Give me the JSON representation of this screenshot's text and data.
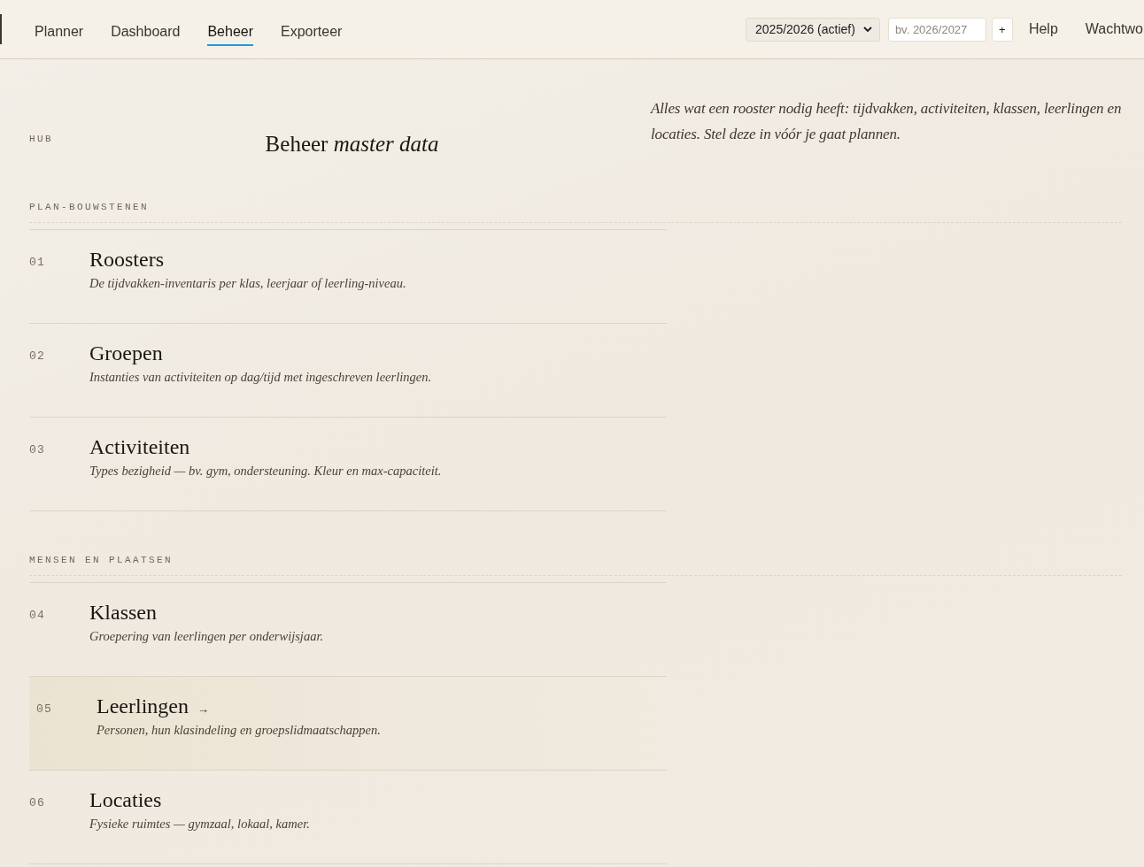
{
  "topbar": {
    "tabs": [
      {
        "label": "Planner",
        "selected": false
      },
      {
        "label": "Dashboard",
        "selected": false
      },
      {
        "label": "Beheer",
        "selected": true
      },
      {
        "label": "Exporteer",
        "selected": false
      }
    ],
    "year_select": "2025/2026 (actief)",
    "new_year": {
      "placeholder": "bv. 2026/2027"
    },
    "add_button": "+",
    "links": [
      "Help",
      "Wachtwo"
    ]
  },
  "header": {
    "eyebrow": "HUB",
    "title": "Beheer *master data*",
    "intro": "Alles wat een rooster nodig heeft: tijdvakken, activiteiten, klassen, leerlingen en locaties. Stel deze in vóór je gaat plannen."
  },
  "sections": [
    {
      "heading": "PLAN-BOUWSTENEN",
      "items": [
        {
          "number": "01",
          "title": "Roosters",
          "description": "De tijdvakken-inventaris per klas, leerjaar of leerling-niveau.",
          "highlighted": false
        },
        {
          "number": "02",
          "title": "Groepen",
          "description": "Instanties van activiteiten op dag/tijd met ingeschreven leerlingen.",
          "highlighted": false
        },
        {
          "number": "03",
          "title": "Activiteiten",
          "description": "Types bezigheid — bv. gym, ondersteuning. Kleur en max-capaciteit.",
          "highlighted": false
        }
      ]
    },
    {
      "heading": "MENSEN EN PLAATSEN",
      "items": [
        {
          "number": "04",
          "title": "Klassen",
          "description": "Groepering van leerlingen per onderwijsjaar.",
          "highlighted": false
        },
        {
          "number": "05",
          "title": "Leerlingen",
          "arrow": "→",
          "description": "Personen, hun klasindeling en groepslidmaatschappen.",
          "highlighted": true
        },
        {
          "number": "06",
          "title": "Locaties",
          "description": "Fysieke ruimtes — gymzaal, lokaal, kamer.",
          "highlighted": false
        }
      ]
    }
  ]
}
